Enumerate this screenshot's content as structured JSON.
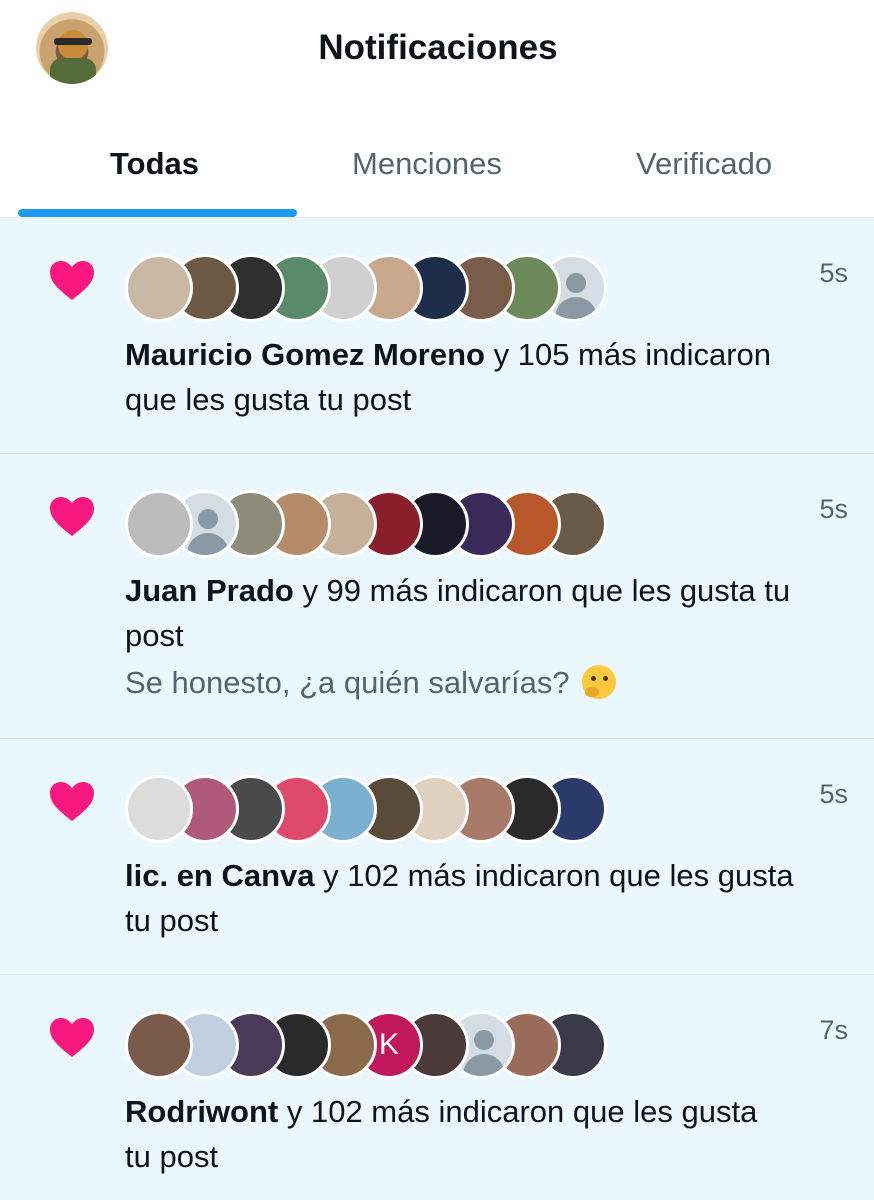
{
  "header": {
    "title": "Notificaciones"
  },
  "tabs": [
    {
      "label": "Todas",
      "active": true
    },
    {
      "label": "Menciones",
      "active": false
    },
    {
      "label": "Verificado",
      "active": false
    }
  ],
  "colors": {
    "accent": "#1d9bf0",
    "heart": "#f91880",
    "list_bg": "#eaf7fd"
  },
  "notifications": [
    {
      "icon": "heart-icon",
      "time": "5s",
      "actor": "Mauricio Gomez Moreno",
      "rest_line1": " y 105 más indicaron",
      "line2": "que les gusta tu post",
      "avatars": [
        "#c9b8a6",
        "#6d5a45",
        "#2f2f2f",
        "#5a8a6a",
        "#d0d0d0",
        "#c7a88a",
        "#1e2d4a",
        "#7a5c4a",
        "#6f8a5a",
        "#d4dde3"
      ]
    },
    {
      "icon": "heart-icon",
      "time": "5s",
      "actor": "Juan Prado",
      "rest_line1": " y 99 más indicaron que les gusta tu",
      "line2": "post",
      "preview": "Se honesto, ¿a quién salvarías?",
      "avatars": [
        "#bcbcbc",
        "#d4dde3",
        "#8c8c7a",
        "#b58c6a",
        "#c7b09a",
        "#8a1e2a",
        "#1a1a2a",
        "#3a2a5a",
        "#b8582a",
        "#6a5a4a"
      ]
    },
    {
      "icon": "heart-icon",
      "time": "5s",
      "actor": "lic. en Canva",
      "rest_line1": " y 102 más indicaron que les gusta",
      "line2": "tu post",
      "avatars": [
        "#dcdcdc",
        "#b05a7a",
        "#4a4a4a",
        "#e04a6a",
        "#7ab0d0",
        "#5a4a3a",
        "#e0d0c0",
        "#a87a6a",
        "#2a2a2a",
        "#2a3a6a"
      ]
    },
    {
      "icon": "heart-icon",
      "time": "7s",
      "actor": "Rodriwont",
      "rest_line1": " y 102 más indicaron que les gusta",
      "line2": "tu post",
      "avatars": [
        "#7a5a4a",
        "#c0d0e0",
        "#4a3a5a",
        "#2a2a2a",
        "#8a6a4a",
        "#c2185b",
        "#4a3a3a",
        "#d4dde3",
        "#9a6a5a",
        "#3a3a4a"
      ],
      "letter_avatar": "K"
    }
  ]
}
